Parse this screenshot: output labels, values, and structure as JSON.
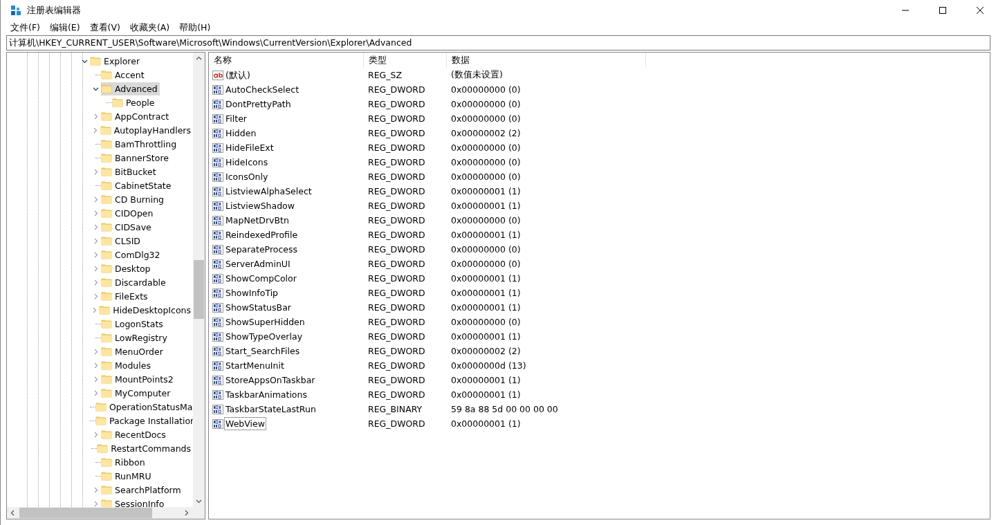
{
  "window": {
    "title": "注册表编辑器"
  },
  "menu": [
    "文件(F)",
    "编辑(E)",
    "查看(V)",
    "收藏夹(A)",
    "帮助(H)"
  ],
  "address": "计算机\\HKEY_CURRENT_USER\\Software\\Microsoft\\Windows\\CurrentVersion\\Explorer\\Advanced",
  "tree": [
    {
      "label": "Explorer",
      "kind": "branch",
      "expanded": true,
      "selected": false,
      "children": [
        {
          "label": "Accent",
          "kind": "leaf",
          "selected": false
        },
        {
          "label": "Advanced",
          "kind": "branch",
          "expanded": true,
          "selected": true,
          "children": [
            {
              "label": "People",
              "kind": "leaf",
              "selected": false
            }
          ]
        },
        {
          "label": "AppContract",
          "kind": "branch",
          "expanded": false,
          "selected": false
        },
        {
          "label": "AutoplayHandlers",
          "kind": "branch",
          "expanded": false,
          "selected": false
        },
        {
          "label": "BamThrottling",
          "kind": "leaf",
          "selected": false
        },
        {
          "label": "BannerStore",
          "kind": "leaf",
          "selected": false
        },
        {
          "label": "BitBucket",
          "kind": "branch",
          "expanded": false,
          "selected": false
        },
        {
          "label": "CabinetState",
          "kind": "leaf",
          "selected": false
        },
        {
          "label": "CD Burning",
          "kind": "branch",
          "expanded": false,
          "selected": false
        },
        {
          "label": "CIDOpen",
          "kind": "branch",
          "expanded": false,
          "selected": false
        },
        {
          "label": "CIDSave",
          "kind": "branch",
          "expanded": false,
          "selected": false
        },
        {
          "label": "CLSID",
          "kind": "branch",
          "expanded": false,
          "selected": false
        },
        {
          "label": "ComDlg32",
          "kind": "branch",
          "expanded": false,
          "selected": false
        },
        {
          "label": "Desktop",
          "kind": "branch",
          "expanded": false,
          "selected": false
        },
        {
          "label": "Discardable",
          "kind": "branch",
          "expanded": false,
          "selected": false
        },
        {
          "label": "FileExts",
          "kind": "branch",
          "expanded": false,
          "selected": false
        },
        {
          "label": "HideDesktopIcons",
          "kind": "branch",
          "expanded": false,
          "selected": false
        },
        {
          "label": "LogonStats",
          "kind": "leaf",
          "selected": false
        },
        {
          "label": "LowRegistry",
          "kind": "leaf",
          "selected": false
        },
        {
          "label": "MenuOrder",
          "kind": "branch",
          "expanded": false,
          "selected": false
        },
        {
          "label": "Modules",
          "kind": "branch",
          "expanded": false,
          "selected": false
        },
        {
          "label": "MountPoints2",
          "kind": "branch",
          "expanded": false,
          "selected": false
        },
        {
          "label": "MyComputer",
          "kind": "branch",
          "expanded": false,
          "selected": false
        },
        {
          "label": "OperationStatusMa",
          "kind": "leaf",
          "selected": false
        },
        {
          "label": "Package Installatior",
          "kind": "leaf",
          "selected": false
        },
        {
          "label": "RecentDocs",
          "kind": "branch",
          "expanded": false,
          "selected": false
        },
        {
          "label": "RestartCommands",
          "kind": "leaf",
          "selected": false
        },
        {
          "label": "Ribbon",
          "kind": "leaf",
          "selected": false
        },
        {
          "label": "RunMRU",
          "kind": "leaf",
          "selected": false
        },
        {
          "label": "SearchPlatform",
          "kind": "branch",
          "expanded": false,
          "selected": false
        },
        {
          "label": "SessionInfo",
          "kind": "branch",
          "expanded": false,
          "selected": false
        }
      ]
    }
  ],
  "table": {
    "columns": [
      "名称",
      "类型",
      "数据"
    ],
    "rows": [
      {
        "kind": "string",
        "name": "(默认)",
        "type": "REG_SZ",
        "data": "(数值未设置)",
        "selected": false
      },
      {
        "kind": "binary",
        "name": "AutoCheckSelect",
        "type": "REG_DWORD",
        "data": "0x00000000 (0)",
        "selected": false
      },
      {
        "kind": "binary",
        "name": "DontPrettyPath",
        "type": "REG_DWORD",
        "data": "0x00000000 (0)",
        "selected": false
      },
      {
        "kind": "binary",
        "name": "Filter",
        "type": "REG_DWORD",
        "data": "0x00000000 (0)",
        "selected": false
      },
      {
        "kind": "binary",
        "name": "Hidden",
        "type": "REG_DWORD",
        "data": "0x00000002 (2)",
        "selected": false
      },
      {
        "kind": "binary",
        "name": "HideFileExt",
        "type": "REG_DWORD",
        "data": "0x00000000 (0)",
        "selected": false
      },
      {
        "kind": "binary",
        "name": "HideIcons",
        "type": "REG_DWORD",
        "data": "0x00000000 (0)",
        "selected": false
      },
      {
        "kind": "binary",
        "name": "IconsOnly",
        "type": "REG_DWORD",
        "data": "0x00000000 (0)",
        "selected": false
      },
      {
        "kind": "binary",
        "name": "ListviewAlphaSelect",
        "type": "REG_DWORD",
        "data": "0x00000001 (1)",
        "selected": false
      },
      {
        "kind": "binary",
        "name": "ListviewShadow",
        "type": "REG_DWORD",
        "data": "0x00000001 (1)",
        "selected": false
      },
      {
        "kind": "binary",
        "name": "MapNetDrvBtn",
        "type": "REG_DWORD",
        "data": "0x00000000 (0)",
        "selected": false
      },
      {
        "kind": "binary",
        "name": "ReindexedProfile",
        "type": "REG_DWORD",
        "data": "0x00000001 (1)",
        "selected": false
      },
      {
        "kind": "binary",
        "name": "SeparateProcess",
        "type": "REG_DWORD",
        "data": "0x00000000 (0)",
        "selected": false
      },
      {
        "kind": "binary",
        "name": "ServerAdminUI",
        "type": "REG_DWORD",
        "data": "0x00000000 (0)",
        "selected": false
      },
      {
        "kind": "binary",
        "name": "ShowCompColor",
        "type": "REG_DWORD",
        "data": "0x00000001 (1)",
        "selected": false
      },
      {
        "kind": "binary",
        "name": "ShowInfoTip",
        "type": "REG_DWORD",
        "data": "0x00000001 (1)",
        "selected": false
      },
      {
        "kind": "binary",
        "name": "ShowStatusBar",
        "type": "REG_DWORD",
        "data": "0x00000001 (1)",
        "selected": false
      },
      {
        "kind": "binary",
        "name": "ShowSuperHidden",
        "type": "REG_DWORD",
        "data": "0x00000000 (0)",
        "selected": false
      },
      {
        "kind": "binary",
        "name": "ShowTypeOverlay",
        "type": "REG_DWORD",
        "data": "0x00000001 (1)",
        "selected": false
      },
      {
        "kind": "binary",
        "name": "Start_SearchFiles",
        "type": "REG_DWORD",
        "data": "0x00000002 (2)",
        "selected": false
      },
      {
        "kind": "binary",
        "name": "StartMenuInit",
        "type": "REG_DWORD",
        "data": "0x0000000d (13)",
        "selected": false
      },
      {
        "kind": "binary",
        "name": "StoreAppsOnTaskbar",
        "type": "REG_DWORD",
        "data": "0x00000001 (1)",
        "selected": false
      },
      {
        "kind": "binary",
        "name": "TaskbarAnimations",
        "type": "REG_DWORD",
        "data": "0x00000001 (1)",
        "selected": false
      },
      {
        "kind": "binary",
        "name": "TaskbarStateLastRun",
        "type": "REG_BINARY",
        "data": "59 8a 88 5d 00 00 00 00",
        "selected": false
      },
      {
        "kind": "binary",
        "name": "WebView",
        "type": "REG_DWORD",
        "data": "0x00000001 (1)",
        "selected": true
      }
    ]
  }
}
